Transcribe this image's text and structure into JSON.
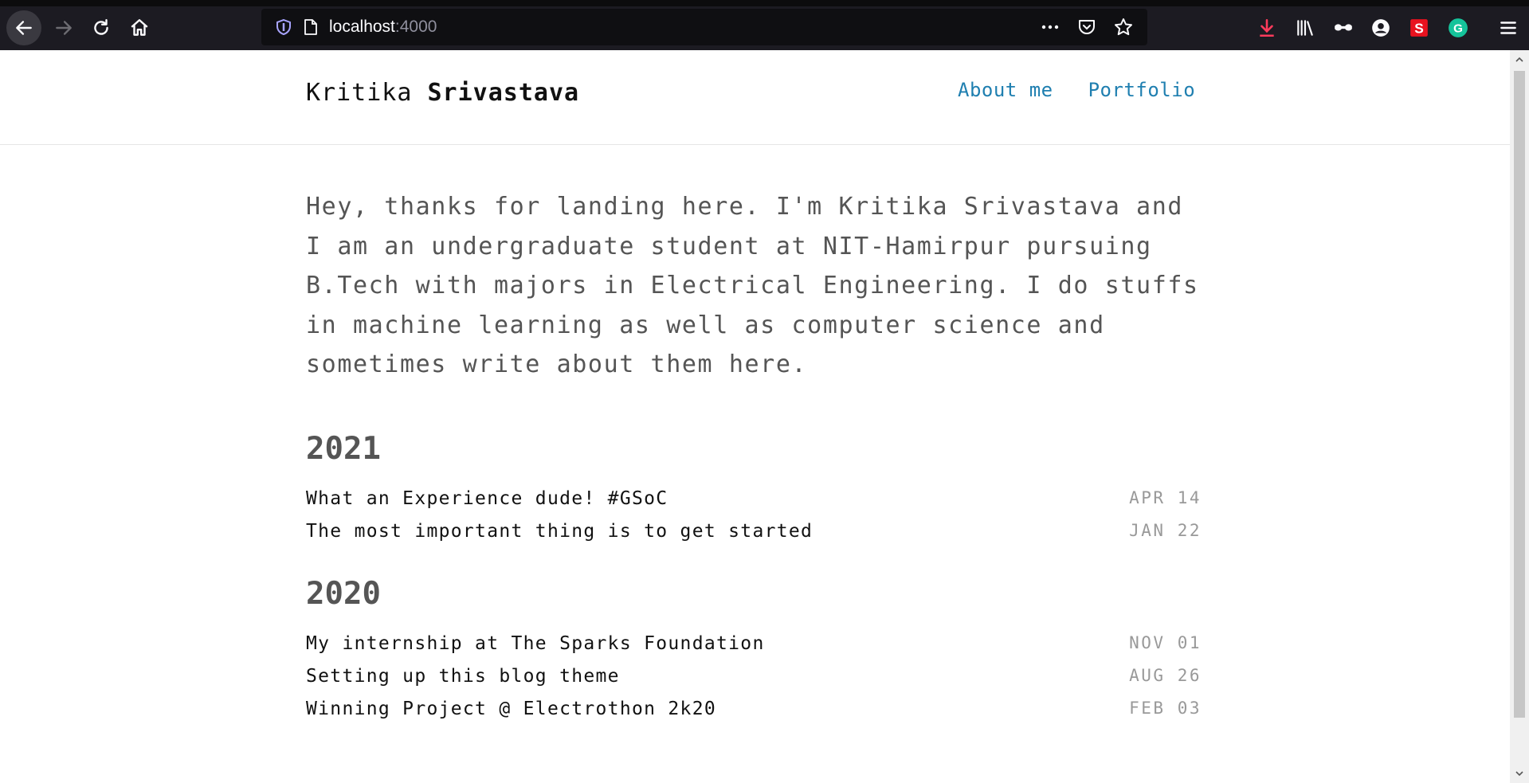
{
  "browser": {
    "url_host": "localhost",
    "url_port": ":4000"
  },
  "site": {
    "title_first": "Kritika",
    "title_last": "Srivastava",
    "nav": [
      {
        "label": "About me"
      },
      {
        "label": "Portfolio"
      }
    ]
  },
  "intro": "Hey, thanks for landing here. I'm Kritika Srivastava and I am an undergraduate student at NIT-Hamirpur pursuing B.Tech with majors in Electrical Engineering. I do stuffs in machine learning as well as computer science and sometimes write about them here.",
  "years": [
    {
      "year": "2021",
      "posts": [
        {
          "title": "What an Experience dude! #GSoC",
          "date": "APR 14"
        },
        {
          "title": "The most important thing is to get started",
          "date": "JAN 22"
        }
      ]
    },
    {
      "year": "2020",
      "posts": [
        {
          "title": "My internship at The Sparks Foundation",
          "date": "NOV 01"
        },
        {
          "title": "Setting up this blog theme",
          "date": "AUG 26"
        },
        {
          "title": "Winning Project @ Electrothon 2k20",
          "date": "FEB 03"
        }
      ]
    }
  ]
}
